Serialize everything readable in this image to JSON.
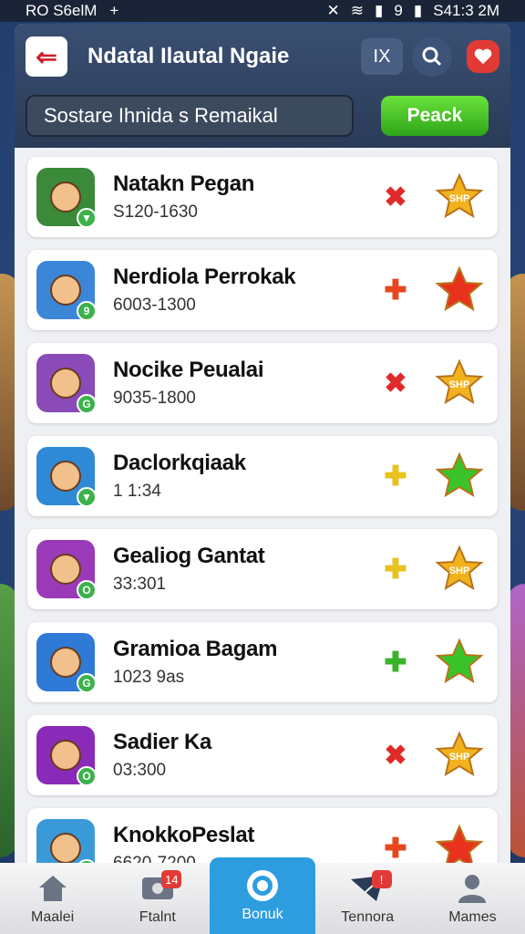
{
  "status": {
    "left_text": "RO S6elM",
    "plus": "+",
    "signal": "9",
    "time": "S41:3 2M"
  },
  "header": {
    "title": "Ndatal Ilautal Ngaie",
    "close_label": "IX",
    "search_value": "Sostare Ihnida s Remaikal",
    "action_label": "Peack"
  },
  "items": [
    {
      "name": "Natakn Pegan",
      "sub": "S120-1630",
      "mark": "✖",
      "mark_color": "#e02a2a",
      "star_color": "#f2b21e",
      "star_text": "SHP",
      "avatar_bg": "#3a8a3a",
      "badge": "▼"
    },
    {
      "name": "Nerdiola Perrokak",
      "sub": "6003-1300",
      "mark": "✚",
      "mark_color": "#e8451e",
      "star_color": "#e8321e",
      "star_text": "",
      "avatar_bg": "#3c86d8",
      "badge": "9"
    },
    {
      "name": "Nocike Peualai",
      "sub": "9035-1800",
      "mark": "✖",
      "mark_color": "#e02a2a",
      "star_color": "#f2b21e",
      "star_text": "SHP",
      "avatar_bg": "#8a4ab8",
      "badge": "G"
    },
    {
      "name": "Daclorkqiaak",
      "sub": "1 1:34",
      "mark": "✚",
      "mark_color": "#e8c21e",
      "star_color": "#3ac22a",
      "star_text": "",
      "avatar_bg": "#2e8ad6",
      "badge": "▼"
    },
    {
      "name": "Gealiog Gantat",
      "sub": "33:301",
      "mark": "✚",
      "mark_color": "#e8c21e",
      "star_color": "#f2b21e",
      "star_text": "SHP",
      "avatar_bg": "#9a3ab8",
      "badge": "O"
    },
    {
      "name": "Gramioa Bagam",
      "sub": "1023 9as",
      "mark": "✚",
      "mark_color": "#3ab22a",
      "star_color": "#3ac22a",
      "star_text": "",
      "avatar_bg": "#2e7ad6",
      "badge": "G"
    },
    {
      "name": "Sadier Ka",
      "sub": "03:300",
      "mark": "✖",
      "mark_color": "#e02a2a",
      "star_color": "#f2b21e",
      "star_text": "SHP",
      "avatar_bg": "#8a2ab8",
      "badge": "O"
    },
    {
      "name": "KnokkoPeslat",
      "sub": "6620-7200",
      "mark": "✚",
      "mark_color": "#e8451e",
      "star_color": "#e8321e",
      "star_text": "",
      "avatar_bg": "#3a9ad8",
      "badge": "▼"
    }
  ],
  "tabs": [
    {
      "label": "Maalei",
      "icon": "home-icon",
      "badge": ""
    },
    {
      "label": "Ftalnt",
      "icon": "photo-icon",
      "badge": "14"
    },
    {
      "label": "Bonuk",
      "icon": "target-icon",
      "badge": ""
    },
    {
      "label": "Tennora",
      "icon": "mail-icon",
      "badge": "!"
    },
    {
      "label": "Mames",
      "icon": "person-icon",
      "badge": ""
    }
  ]
}
